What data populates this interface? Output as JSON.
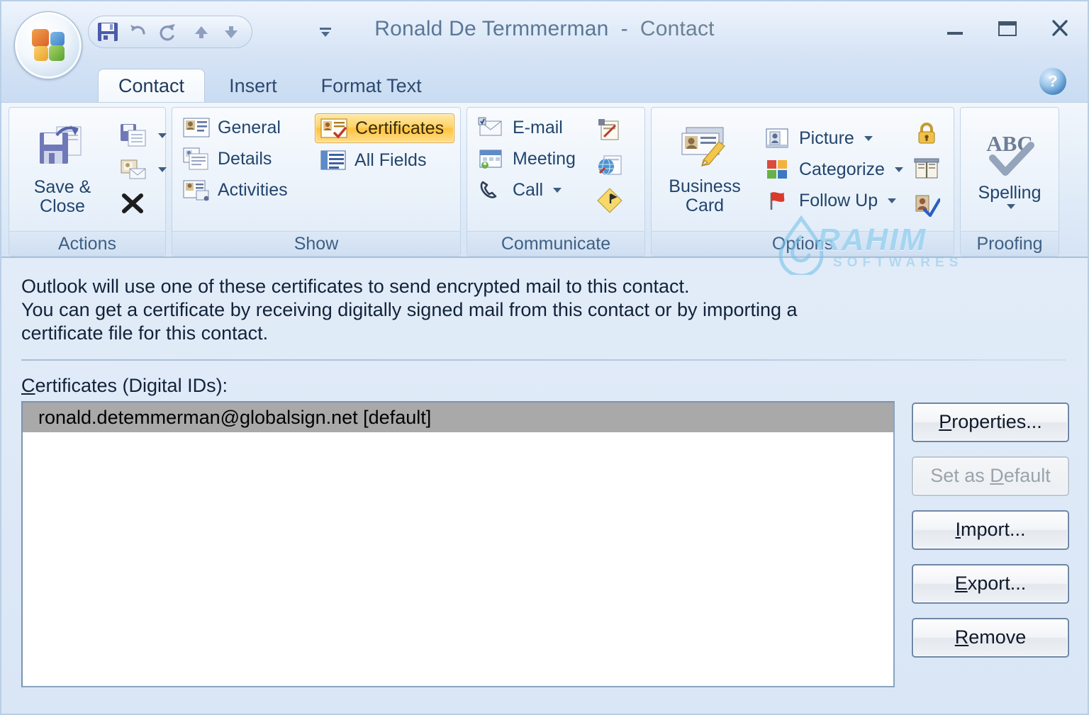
{
  "window": {
    "title_name": "Ronald De Termmerman",
    "title_sep": "  -  ",
    "title_type": "Contact",
    "minimize_label": "Minimize",
    "maximize_label": "Maximize",
    "close_label": "Close"
  },
  "office_button": {
    "label": "Office Button"
  },
  "quick_access": {
    "items": [
      {
        "name": "save",
        "label": "Save"
      },
      {
        "name": "undo",
        "label": "Undo"
      },
      {
        "name": "redo",
        "label": "Redo"
      },
      {
        "name": "previous",
        "label": "Previous Item"
      },
      {
        "name": "next",
        "label": "Next Item"
      }
    ],
    "customize_label": "Customize Quick Access Toolbar"
  },
  "tabs": [
    {
      "label": "Contact",
      "active": true
    },
    {
      "label": "Insert",
      "active": false
    },
    {
      "label": "Format Text",
      "active": false
    }
  ],
  "help": {
    "label": "?"
  },
  "ribbon": {
    "groups": [
      {
        "label": "Actions",
        "big": {
          "label_line1": "Save &",
          "label_line2": "Close",
          "icon": "save-and-close-icon"
        },
        "small": [
          {
            "label": "Save & New",
            "icon": "save-new-icon",
            "caret": true
          },
          {
            "label": "Send",
            "icon": "send-icon",
            "caret": true
          },
          {
            "label": "Delete",
            "icon": "delete-x-icon",
            "caret": false
          }
        ]
      },
      {
        "label": "Show",
        "items": [
          {
            "label": "General",
            "icon": "general-card-icon",
            "selected": false
          },
          {
            "label": "Certificates",
            "icon": "certificates-icon",
            "selected": true
          },
          {
            "label": "Details",
            "icon": "details-icon",
            "selected": false
          },
          {
            "label": "All Fields",
            "icon": "all-fields-icon",
            "selected": false
          },
          {
            "label": "Activities",
            "icon": "activities-icon",
            "selected": false
          }
        ]
      },
      {
        "label": "Communicate",
        "items": [
          {
            "label": "E-mail",
            "icon": "email-icon"
          },
          {
            "label": "Meeting",
            "icon": "meeting-icon"
          },
          {
            "label": "Call",
            "icon": "call-phone-icon",
            "caret": true
          }
        ],
        "extra_icons": [
          {
            "name": "assign-task-icon"
          },
          {
            "name": "web-page-icon"
          },
          {
            "name": "map-icon"
          }
        ]
      },
      {
        "label": "Options",
        "big": {
          "label_line1": "Business",
          "label_line2": "Card",
          "icon": "business-card-icon"
        },
        "small": [
          {
            "label": "Picture",
            "icon": "picture-icon",
            "caret": true
          },
          {
            "label": "Categorize",
            "icon": "categorize-icon",
            "caret": true
          },
          {
            "label": "Follow Up",
            "icon": "follow-up-flag-icon",
            "caret": true
          }
        ],
        "extra_icons": [
          {
            "name": "private-lock-icon"
          },
          {
            "name": "address-book-icon"
          },
          {
            "name": "check-names-icon"
          }
        ]
      },
      {
        "label": "Proofing",
        "big": {
          "label_line1": "Spelling",
          "label_line2": "",
          "icon": "spelling-abc-icon",
          "caret": true
        }
      }
    ]
  },
  "body": {
    "description_line1": "Outlook will use one of these certificates to send encrypted mail to this contact.",
    "description_line2": "You can get a certificate by receiving digitally signed mail from this contact or by importing a",
    "description_line3": "certificate file for this contact.",
    "list_label_accel": "C",
    "list_label_rest": "ertificates (Digital IDs):"
  },
  "certificates_list": {
    "items": [
      {
        "text": "ronald.detemmerman@globalsign.net [default]",
        "selected": true
      }
    ]
  },
  "action_buttons": [
    {
      "accel": "P",
      "rest": "roperties...",
      "pre": "",
      "name": "properties-button",
      "disabled": false
    },
    {
      "accel": "D",
      "rest": "efault",
      "pre": "Set as ",
      "name": "set-as-default-button",
      "disabled": true
    },
    {
      "accel": "I",
      "rest": "mport...",
      "pre": "",
      "name": "import-button",
      "disabled": false
    },
    {
      "accel": "E",
      "rest": "xport...",
      "pre": "",
      "name": "export-button",
      "disabled": false
    },
    {
      "accel": "R",
      "rest": "emove",
      "pre": "",
      "name": "remove-button",
      "disabled": false
    }
  ],
  "watermark": {
    "text": "RAHIM",
    "subtext": "SOFTWARES"
  },
  "colors": {
    "accent_selected": "#ffc33f",
    "title_text": "#5a7798",
    "ribbon_text": "#22456d",
    "selection_gray": "#a9a9a9",
    "watermark_blue": "#78c3eb"
  }
}
